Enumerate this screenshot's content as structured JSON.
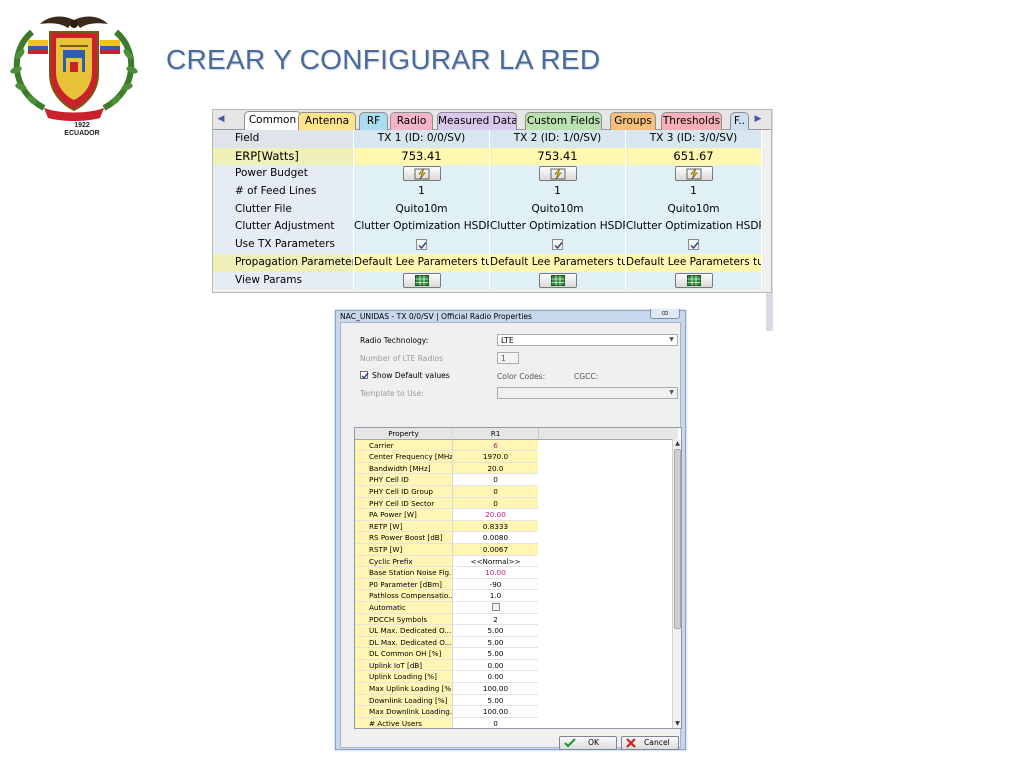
{
  "slide": {
    "title": "CREAR Y CONFIGURAR LA RED",
    "emblem": {
      "year": "1922",
      "name": "ECUADOR"
    }
  },
  "tx_grid": {
    "tabs": [
      "Common",
      "Antenna",
      "RF",
      "Radio",
      "Measured Data",
      "Custom Fields",
      "Groups",
      "Thresholds",
      "F.."
    ],
    "tab_colors": [
      "#ffffff",
      "#fde48a",
      "#a9dcef",
      "#f6b4c8",
      "#d9c8ee",
      "#b9e2b0",
      "#f6c07a",
      "#f7b0b8",
      "#cfe0f2"
    ],
    "active_tab": "Common",
    "columns": [
      "Field",
      "TX 1 (ID: 0/0/SV)",
      "TX 2 (ID: 1/0/SV)",
      "TX 3 (ID: 3/0/SV)"
    ],
    "rows": [
      {
        "label": "ERP[Watts]",
        "type": "text",
        "values": [
          "753.41",
          "753.41",
          "651.67"
        ]
      },
      {
        "label": "Power Budget",
        "type": "button-power"
      },
      {
        "label": "# of Feed Lines",
        "type": "text",
        "values": [
          "1",
          "1",
          "1"
        ]
      },
      {
        "label": "Clutter File",
        "type": "text",
        "values": [
          "Quito10m",
          "Quito10m",
          "Quito10m"
        ]
      },
      {
        "label": "Clutter Adjustment",
        "type": "text",
        "values": [
          "Clutter Optimization HSDPA...",
          "Clutter Optimization HSDPA...",
          "Clutter Optimization HSDPA..."
        ]
      },
      {
        "label": "Use TX Parameters",
        "type": "checkbox",
        "checked": [
          true,
          true,
          true
        ]
      },
      {
        "label": "Propagation Parameters",
        "type": "text",
        "values": [
          "Default Lee Parameters tur...",
          "Default Lee Parameters tur...",
          "Default Lee Parameters tur..."
        ]
      },
      {
        "label": "View Params",
        "type": "button-grid"
      }
    ]
  },
  "dialog": {
    "title": "NAC_UNIDAS - TX 0/0/SV | Official Radio Properties",
    "close_icon": "close-icon",
    "radio_technology_label": "Radio Technology:",
    "radio_technology_value": "LTE",
    "num_radios_label": "Number of LTE Radios",
    "num_radios_value": "1",
    "show_default_label": "Show Default values",
    "show_default_checked": true,
    "color_codes_label": "Color Codes:",
    "cgcc_label": "CGCC:",
    "template_label": "Template to Use:",
    "template_value": "",
    "grid_headers": [
      "Property",
      "R1"
    ],
    "properties": [
      {
        "name": "Carrier",
        "value": "6",
        "style": "yel-pink"
      },
      {
        "name": "Center Frequency [MHz]",
        "value": "1970.0",
        "style": "yel"
      },
      {
        "name": "Bandwidth [MHz]",
        "value": "20.0",
        "style": "yel"
      },
      {
        "name": "PHY Cell ID",
        "value": "0",
        "style": "wht"
      },
      {
        "name": "PHY Cell ID Group",
        "value": "0",
        "style": "yel"
      },
      {
        "name": "PHY Cell ID Sector",
        "value": "0",
        "style": "yel"
      },
      {
        "name": "PA Power [W]",
        "value": "20.00",
        "style": "wht-pink"
      },
      {
        "name": "RETP [W]",
        "value": "0.8333",
        "style": "yel"
      },
      {
        "name": "RS Power Boost [dB]",
        "value": "0.0080",
        "style": "wht"
      },
      {
        "name": "RSTP [W]",
        "value": "0.0067",
        "style": "yel"
      },
      {
        "name": "Cyclic Prefix",
        "value": "<<Normal>>",
        "style": "wht"
      },
      {
        "name": "Base Station Noise Fig...",
        "value": "10.00",
        "style": "wht-pink"
      },
      {
        "name": "P0 Parameter [dBm]",
        "value": "-90",
        "style": "wht"
      },
      {
        "name": "Pathloss Compensatio...",
        "value": "1.0",
        "style": "wht"
      },
      {
        "name": "Automatic",
        "value": "",
        "style": "checkbox"
      },
      {
        "name": "PDCCH Symbols",
        "value": "2",
        "style": "wht"
      },
      {
        "name": "UL Max. Dedicated O...",
        "value": "5.00",
        "style": "wht"
      },
      {
        "name": "DL Max. Dedicated O...",
        "value": "5.00",
        "style": "wht"
      },
      {
        "name": "DL Common OH [%]",
        "value": "5.00",
        "style": "wht"
      },
      {
        "name": "Uplink IoT [dB]",
        "value": "0.00",
        "style": "wht"
      },
      {
        "name": "Uplink Loading [%]",
        "value": "0.00",
        "style": "wht"
      },
      {
        "name": "Max Uplink Loading [%]",
        "value": "100.00",
        "style": "wht"
      },
      {
        "name": "Downlink Loading [%]",
        "value": "5.00",
        "style": "wht"
      },
      {
        "name": "Max Downlink Loading...",
        "value": "100.00",
        "style": "wht"
      },
      {
        "name": "# Active Users",
        "value": "0",
        "style": "wht"
      }
    ],
    "ok_label": "OK",
    "cancel_label": "Cancel"
  }
}
